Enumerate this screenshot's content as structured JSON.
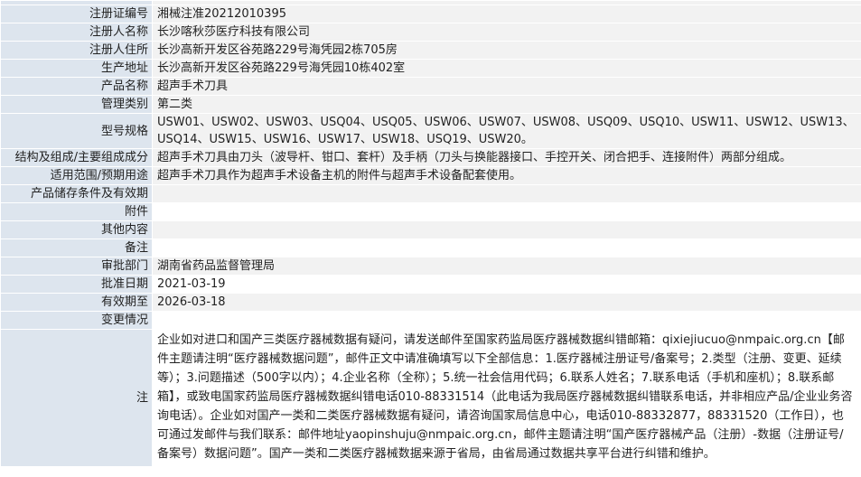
{
  "rows": [
    {
      "label": "注册证编号",
      "value": "湘械注准20212010395"
    },
    {
      "label": "注册人名称",
      "value": "长沙喀秋莎医疗科技有限公司"
    },
    {
      "label": "注册人住所",
      "value": "长沙高新开发区谷苑路229号海凭园2栋705房"
    },
    {
      "label": "生产地址",
      "value": "长沙高新开发区谷苑路229号海凭园10栋402室"
    },
    {
      "label": "产品名称",
      "value": "超声手术刀具"
    },
    {
      "label": "管理类别",
      "value": "第二类"
    },
    {
      "label": "型号规格",
      "value": "USW01、USW02、USW03、USQ04、USQ05、USW06、USW07、USW08、USQ09、USQ10、USW11、USW12、USW13、USQ14、USW15、USW16、USW17、USW18、USQ19、USW20。"
    },
    {
      "label": "结构及组成/主要组成成分",
      "value": "超声手术刀具由刀头（波导杆、钳口、套杆）及手柄（刀头与换能器接口、手控开关、闭合把手、连接附件）两部分组成。"
    },
    {
      "label": "适用范围/预期用途",
      "value": "超声手术刀具作为超声手术设备主机的附件与超声手术设备配套使用。"
    },
    {
      "label": "产品储存条件及有效期",
      "value": ""
    },
    {
      "label": "附件",
      "value": ""
    },
    {
      "label": "其他内容",
      "value": ""
    },
    {
      "label": "备注",
      "value": ""
    },
    {
      "label": "审批部门",
      "value": "湖南省药品监督管理局"
    },
    {
      "label": "批准日期",
      "value": "2021-03-19"
    },
    {
      "label": "有效期至",
      "value": "2026-03-18"
    },
    {
      "label": "变更情况",
      "value": ""
    }
  ],
  "note": {
    "label": "注",
    "text": "企业如对进口和国产三类医疗器械数据有疑问，请发送邮件至国家药监局医疗器械数据纠错邮箱：qixiejiucuo@nmpaic.org.cn【邮件主题请注明“医疗器械数据问题”，邮件正文中请准确填写以下全部信息：1.医疗器械注册证号/备案号；2.类型（注册、变更、延续等）；3.问题描述（500字以内）；4.企业名称（全称）；5.统一社会信用代码；6.联系人姓名；7.联系电话（手机和座机）；8.联系邮箱】，或致电国家药监局医疗器械数据纠错电话010-88331514（此电话为我局医疗器械数据纠错联系电话，并非相应产品/企业业务咨询电话）。企业如对国产一类和二类医疗器械数据有疑问，请咨询国家局信息中心，电话010-88332877，88331520（工作日），也可通过发邮件与我们联系：邮件地址yaopinshuju@nmpaic.org.cn，邮件主题请注明“国产医疗器械产品（注册）-数据（注册证号/备案号）数据问题”。国产一类和二类医疗器械数据来源于省局，由省局通过数据共享平台进行纠错和维护。"
  }
}
